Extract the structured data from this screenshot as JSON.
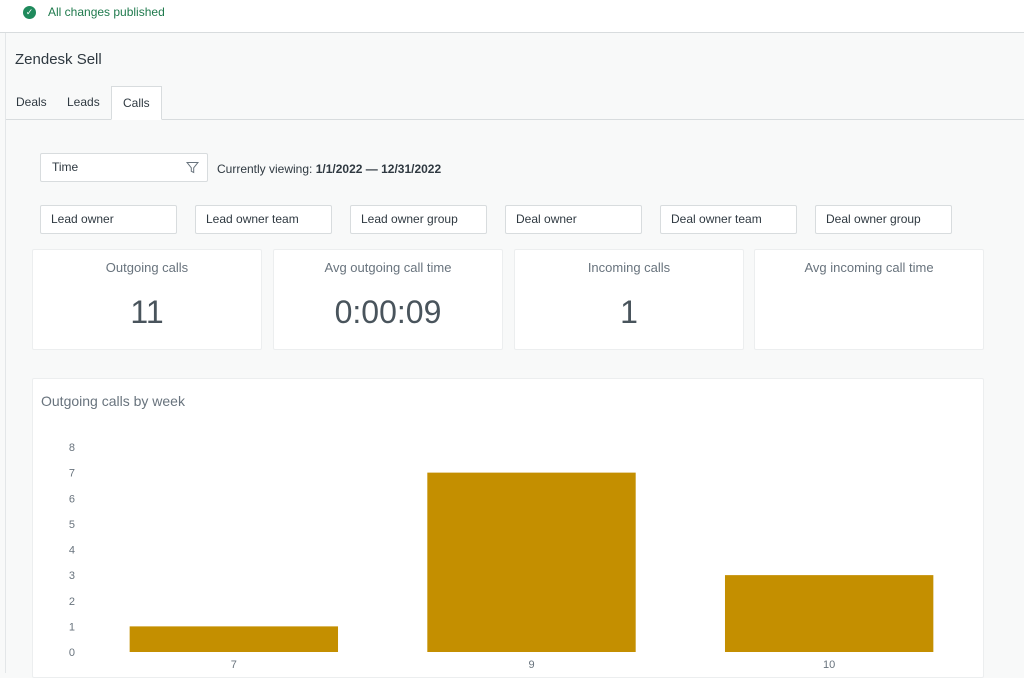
{
  "status": {
    "text": "All changes published",
    "icon": "check-circle-icon"
  },
  "app": {
    "title": "Zendesk Sell"
  },
  "tabs": [
    {
      "label": "Deals"
    },
    {
      "label": "Leads"
    },
    {
      "label": "Calls",
      "active": true
    }
  ],
  "filters": {
    "time_label": "Time",
    "viewing_prefix": "Currently viewing:",
    "viewing_range": "1/1/2022 — 12/31/2022",
    "buttons": [
      "Lead owner",
      "Lead owner team",
      "Lead owner group",
      "Deal owner",
      "Deal owner team",
      "Deal owner group"
    ]
  },
  "kpis": [
    {
      "label": "Outgoing calls",
      "value": "11"
    },
    {
      "label": "Avg outgoing call time",
      "value": "0:00:09"
    },
    {
      "label": "Incoming calls",
      "value": "1"
    },
    {
      "label": "Avg incoming call time",
      "value": ""
    }
  ],
  "chart_data": {
    "type": "bar",
    "title": "Outgoing calls by week",
    "categories": [
      "7",
      "9",
      "10"
    ],
    "values": [
      1,
      7,
      3
    ],
    "ylim": [
      0,
      8
    ],
    "yticks": [
      "0",
      "1",
      "2",
      "3",
      "4",
      "5",
      "6",
      "7",
      "8"
    ],
    "bar_color": "#c48f00",
    "grid": false
  },
  "colors": {
    "accent": "#1f8a5c",
    "bar": "#c48f00"
  }
}
